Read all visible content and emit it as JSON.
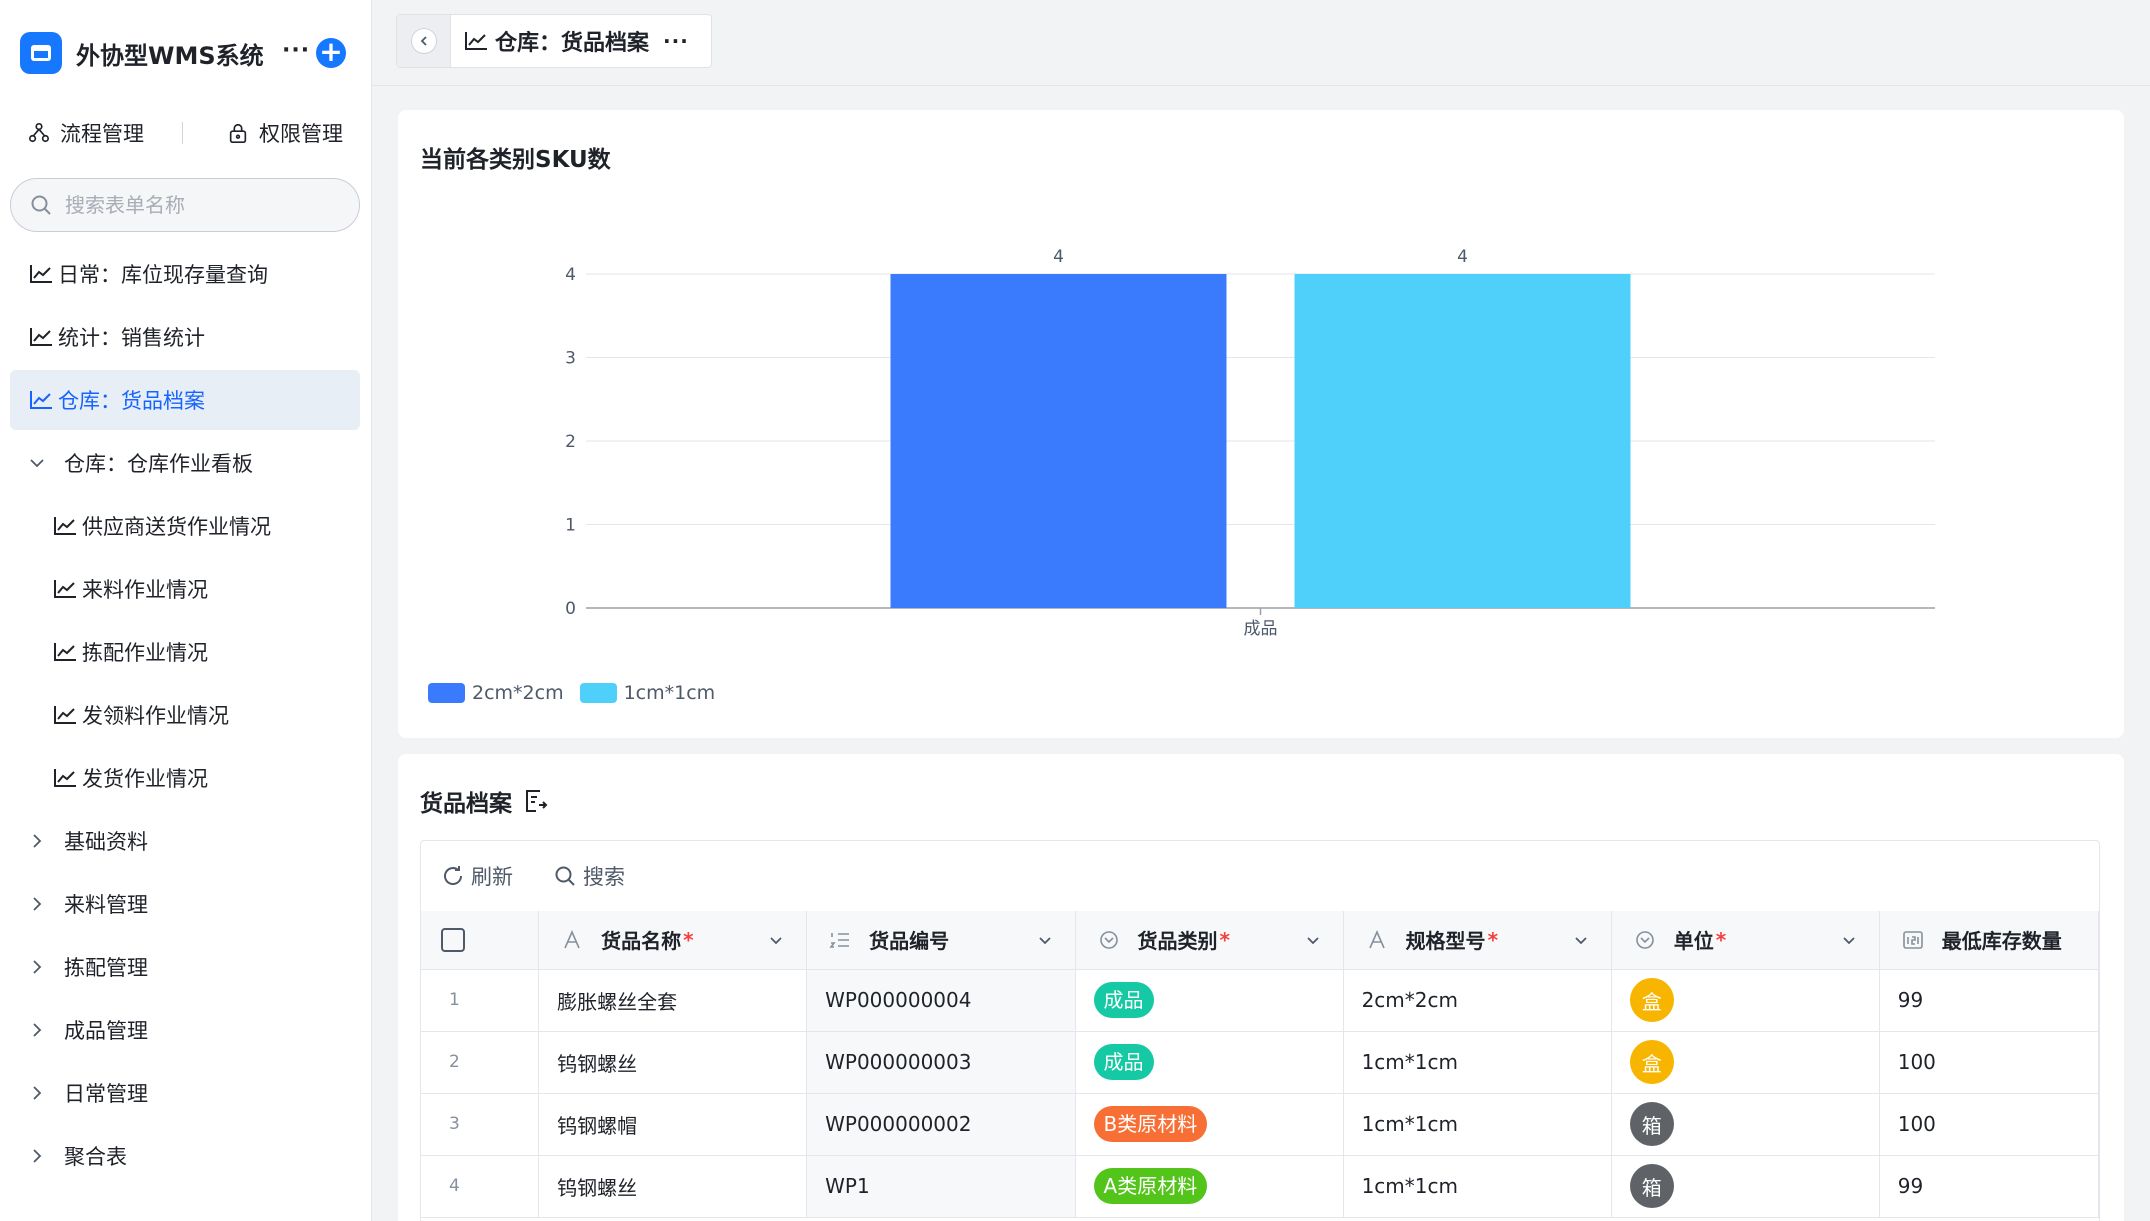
{
  "app": {
    "title": "外协型WMS系统",
    "more": "···",
    "add": "+"
  },
  "top_links": [
    {
      "label": "流程管理",
      "icon": "flow-icon"
    },
    {
      "label": "权限管理",
      "icon": "lock-icon"
    }
  ],
  "search": {
    "placeholder": "搜索表单名称"
  },
  "nav": [
    {
      "label": "日常：库位现存量查询",
      "type": "chart",
      "level": 0,
      "active": false
    },
    {
      "label": "统计：销售统计",
      "type": "chart",
      "level": 0,
      "active": false
    },
    {
      "label": "仓库：货品档案",
      "type": "chart",
      "level": 0,
      "active": true
    },
    {
      "label": "仓库：仓库作业看板",
      "type": "group-open",
      "level": 0,
      "active": false
    },
    {
      "label": "供应商送货作业情况",
      "type": "chart",
      "level": 1,
      "active": false
    },
    {
      "label": "来料作业情况",
      "type": "chart",
      "level": 1,
      "active": false
    },
    {
      "label": "拣配作业情况",
      "type": "chart",
      "level": 1,
      "active": false
    },
    {
      "label": "发领料作业情况",
      "type": "chart",
      "level": 1,
      "active": false
    },
    {
      "label": "发货作业情况",
      "type": "chart",
      "level": 1,
      "active": false
    },
    {
      "label": "基础资料",
      "type": "group",
      "level": 0,
      "active": false
    },
    {
      "label": "来料管理",
      "type": "group",
      "level": 0,
      "active": false
    },
    {
      "label": "拣配管理",
      "type": "group",
      "level": 0,
      "active": false
    },
    {
      "label": "成品管理",
      "type": "group",
      "level": 0,
      "active": false
    },
    {
      "label": "日常管理",
      "type": "group",
      "level": 0,
      "active": false
    },
    {
      "label": "聚合表",
      "type": "group",
      "level": 0,
      "active": false
    }
  ],
  "tab": {
    "label": "仓库：货品档案",
    "more": "···"
  },
  "chart_card": {
    "title": "当前各类别SKU数"
  },
  "chart_data": {
    "type": "bar",
    "categories": [
      "成品"
    ],
    "series": [
      {
        "name": "2cm*2cm",
        "values": [
          4
        ],
        "color": "#3a7bfd"
      },
      {
        "name": "1cm*1cm",
        "values": [
          4
        ],
        "color": "#4fd0fa"
      }
    ],
    "ylim": [
      0,
      4
    ],
    "yticks": [
      "0",
      "1",
      "2",
      "3",
      "4"
    ],
    "grid": true,
    "legend": "bottom-left",
    "data_labels": true
  },
  "table_card": {
    "title": "货品档案",
    "toolbar": {
      "refresh": "刷新",
      "search": "搜索"
    },
    "columns": [
      {
        "label": "货品名称",
        "required": true,
        "icon": "text-type-icon"
      },
      {
        "label": "货品编号",
        "required": false,
        "icon": "sequence-icon"
      },
      {
        "label": "货品类别",
        "required": true,
        "icon": "select-type-icon"
      },
      {
        "label": "规格型号",
        "required": true,
        "icon": "text-type-icon"
      },
      {
        "label": "单位",
        "required": true,
        "icon": "select-type-icon"
      },
      {
        "label": "最低库存数量",
        "required": false,
        "icon": "number-type-icon"
      }
    ],
    "rows": [
      {
        "idx": "1",
        "name": "膨胀螺丝全套",
        "code": "WP000000004",
        "category": "成品",
        "cat_color": "#14c9a3",
        "spec": "2cm*2cm",
        "unit": "盒",
        "unit_color": "#f7b500",
        "min_qty": "99"
      },
      {
        "idx": "2",
        "name": "钨钢螺丝",
        "code": "WP000000003",
        "category": "成品",
        "cat_color": "#14c9a3",
        "spec": "1cm*1cm",
        "unit": "盒",
        "unit_color": "#f7b500",
        "min_qty": "100"
      },
      {
        "idx": "3",
        "name": "钨钢螺帽",
        "code": "WP000000002",
        "category": "B类原材料",
        "cat_color": "#f86f35",
        "spec": "1cm*1cm",
        "unit": "箱",
        "unit_color": "#5f6368",
        "min_qty": "100"
      },
      {
        "idx": "4",
        "name": "钨钢螺丝",
        "code": "WP1",
        "category": "A类原材料",
        "cat_color": "#53c41a",
        "spec": "1cm*1cm",
        "unit": "箱",
        "unit_color": "#5f6368",
        "min_qty": "99"
      }
    ]
  }
}
